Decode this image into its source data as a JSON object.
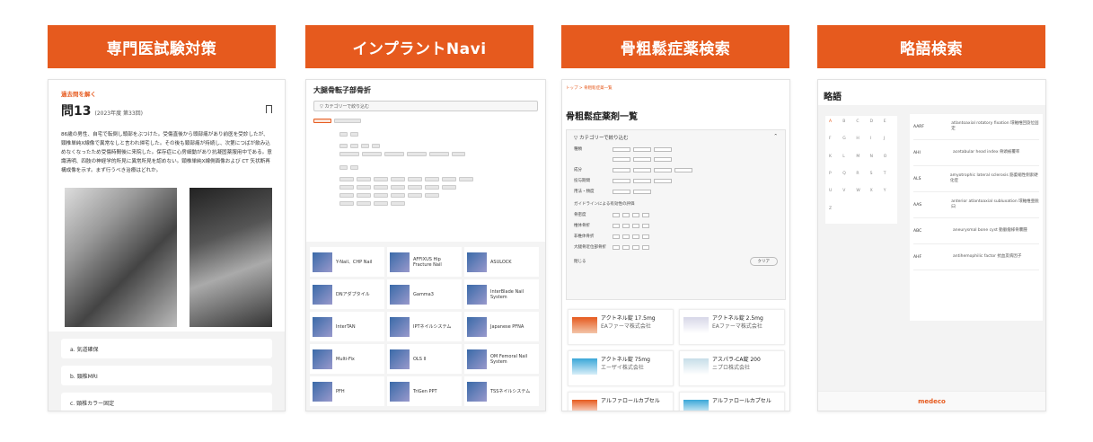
{
  "headers": [
    "専門医試験対策",
    "インプラントNavi",
    "骨粗鬆症薬検索",
    "略語検索"
  ],
  "panel1": {
    "tag": "過去問を解く",
    "question_no": "問13",
    "question_sub": "(2023年度 第33回)",
    "body": "86歳の男性、自宅で転倒し頭部をぶつけた。受傷直後から頭部痛があり前医を受診したが、頸椎単純X線像で異常なしと言われ帰宅した。その後も頸部痛が持続し、次第につばが飲み込めなくなったため受傷時間後に来院した。保存症に心房細動があり抗凝固薬服用中である。意識清明、四肢の神経学的所見に異常所見を認めない。頸椎単純X線側面像および CT 矢状断再構成像を示す。まず行うべき治療はどれか。",
    "options": [
      "a. 気道確保",
      "b. 頸椎MRI",
      "c. 頸椎カラー固定"
    ]
  },
  "panel2": {
    "title": "大腿骨転子部骨折",
    "filter_label": "カテゴリーで絞り込む",
    "products": [
      "Y-Nail、CHP Nail",
      "AFFIXUS Hip Fracture Nail",
      "ASULOCK",
      "DNアダプタイル",
      "Gamma3",
      "InterBlade Nail System",
      "InterTAN",
      "IPTネイルシステム",
      "Japanese PFNA",
      "Multi-Fix",
      "OLS II",
      "OM Femoral Nail System",
      "PFH",
      "TriGen PPT",
      "TSSネイルシステム"
    ]
  },
  "panel3": {
    "breadcrumb": "トップ > 骨粗鬆症薬一覧",
    "title": "骨粗鬆症薬剤一覧",
    "filter_label": "カテゴリーで絞り込む",
    "filter_rows": [
      "種類",
      "成分",
      "投与期間",
      "用法・頻度",
      "投与経路"
    ],
    "guideline_title": "ガイドラインによる有効性の評価",
    "guideline_rows": [
      "骨密度",
      "椎体骨折",
      "非椎体骨折",
      "大腿骨近位部骨折"
    ],
    "collapse_label": "閉じる",
    "clear_label": "クリア",
    "drugs": [
      {
        "name": "アクトネル錠 17.5mg",
        "maker": "EAファーマ株式会社"
      },
      {
        "name": "アクトネル錠 2.5mg",
        "maker": "EAファーマ株式会社"
      },
      {
        "name": "アクトネル錠 75mg",
        "maker": "エーザイ株式会社"
      },
      {
        "name": "アスパラ-CA錠 200",
        "maker": "ニプロ株式会社"
      },
      {
        "name": "アルファロールカプセル",
        "maker": ""
      },
      {
        "name": "アルファロールカプセル",
        "maker": ""
      }
    ]
  },
  "panel4": {
    "title": "略語",
    "letters": [
      "A",
      "B",
      "C",
      "D",
      "E",
      "F",
      "G",
      "H",
      "I",
      "J",
      "K",
      "L",
      "M",
      "N",
      "O",
      "P",
      "Q",
      "R",
      "S",
      "T",
      "U",
      "V",
      "W",
      "X",
      "Y",
      "Z"
    ],
    "entries": [
      {
        "abbr": "AARF",
        "desc": "atlantoaxial rotatory fixation 環軸椎回旋位固定"
      },
      {
        "abbr": "AHI",
        "desc": "acetabular head index 骨頭被覆率"
      },
      {
        "abbr": "ALS",
        "desc": "amyotrophic lateral sclerosis 筋萎縮性側索硬化症"
      },
      {
        "abbr": "AAS",
        "desc": "anterior atlantoaxial subluxation 環軸椎亜脱臼"
      },
      {
        "abbr": "ABC",
        "desc": "aneurysmal bone cyst 動脈瘤様骨嚢腫"
      },
      {
        "abbr": "AHF",
        "desc": "antihemophilic factor 抗血友病因子"
      }
    ],
    "footer": "medeco"
  },
  "colors": {
    "accent": "#e65a1e"
  }
}
